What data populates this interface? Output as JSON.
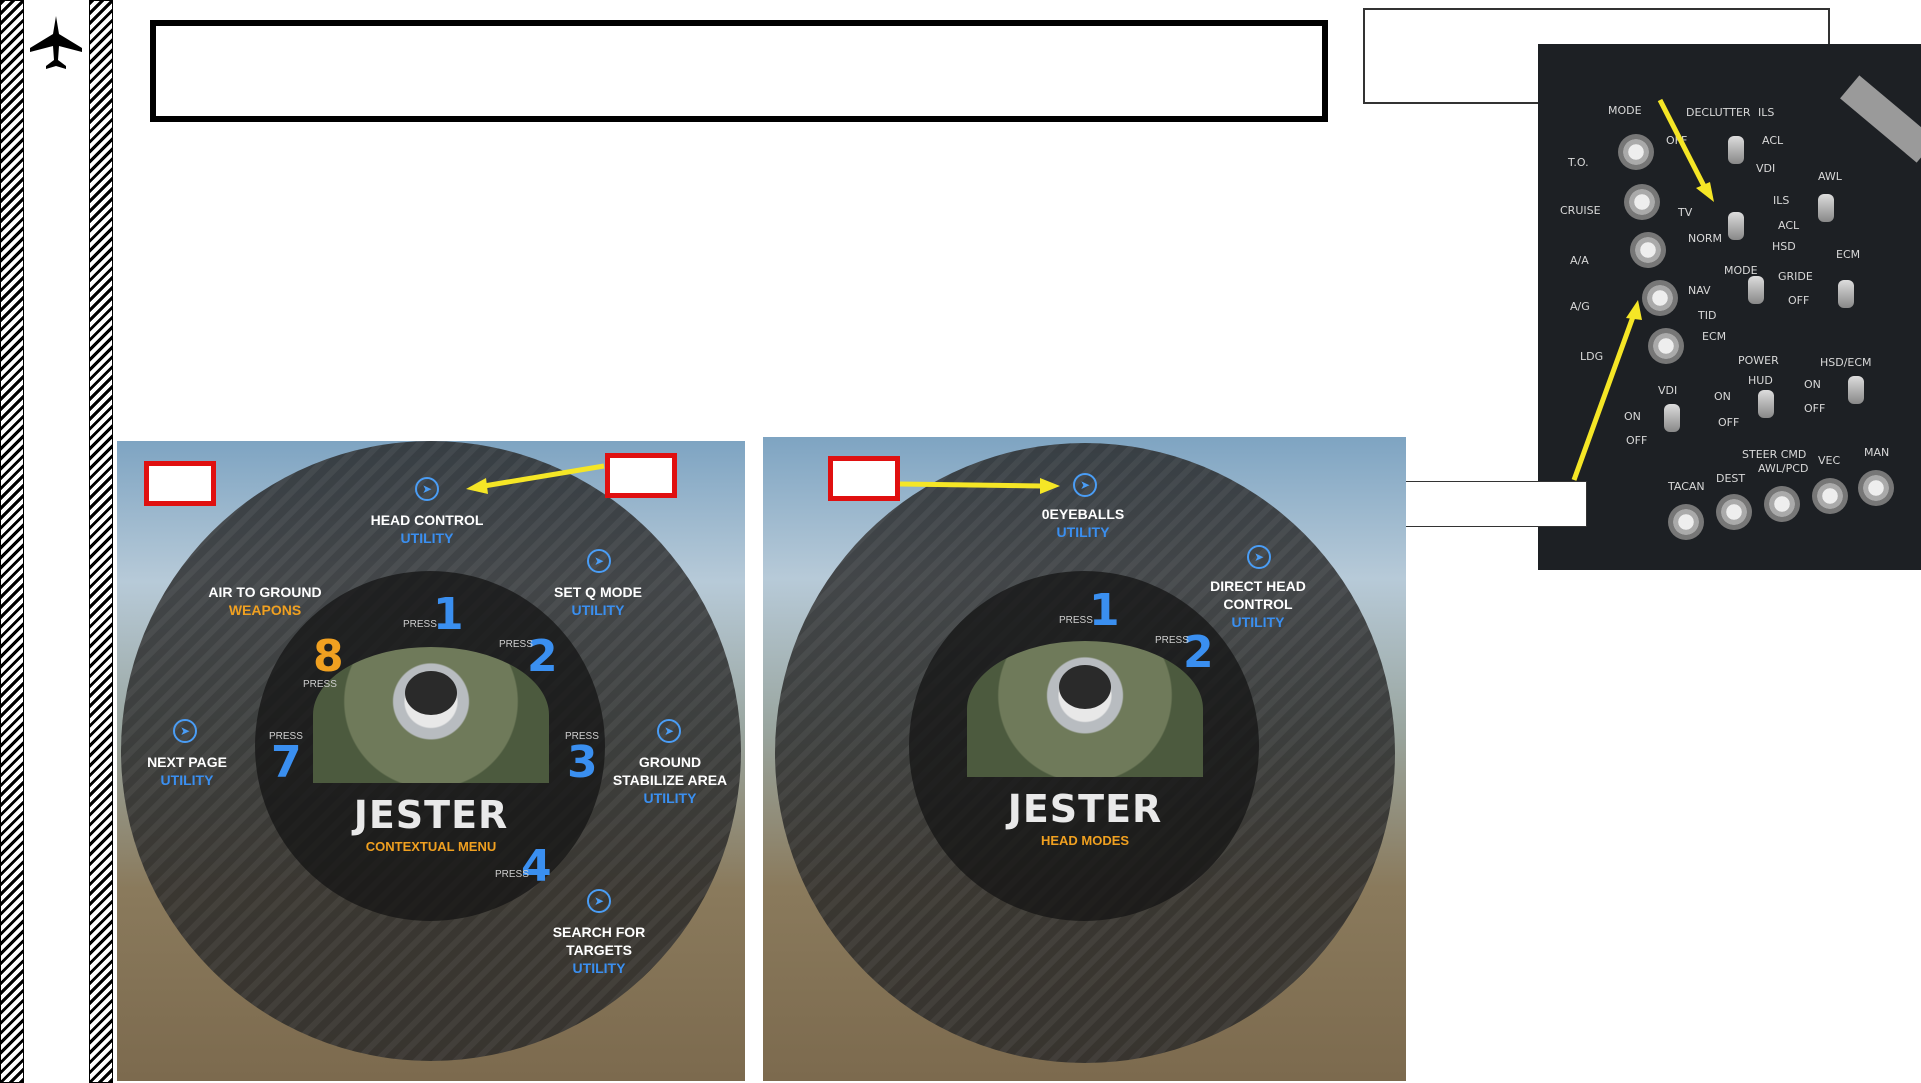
{
  "header": {
    "title_text": "",
    "note_text": ""
  },
  "left_menu": {
    "center_title": "JESTER",
    "center_subtitle": "CONTEXTUAL MENU",
    "press_label": "PRESS",
    "items": [
      {
        "label": "HEAD CONTROL",
        "category": "UTILITY",
        "key": "1"
      },
      {
        "label": "SET Q MODE",
        "category": "UTILITY",
        "key": "2"
      },
      {
        "label": "GROUND STABILIZE AREA",
        "category": "UTILITY",
        "key": "3"
      },
      {
        "label": "SEARCH FOR TARGETS",
        "category": "UTILITY",
        "key": "4"
      },
      {
        "label": "NEXT PAGE",
        "category": "UTILITY",
        "key": "7"
      },
      {
        "label": "AIR TO GROUND",
        "category": "WEAPONS",
        "key": "8"
      }
    ]
  },
  "right_menu": {
    "center_title": "JESTER",
    "center_subtitle": "HEAD MODES",
    "press_label": "PRESS",
    "items": [
      {
        "label": "0EYEBALLS",
        "category": "UTILITY",
        "key": "1"
      },
      {
        "label": "DIRECT HEAD CONTROL",
        "category": "UTILITY",
        "key": "2"
      }
    ]
  },
  "panel": {
    "labels": {
      "mode": "MODE",
      "declutter": "DECLUTTER",
      "on": "ON",
      "off": "OFF",
      "ils": "ILS",
      "acl": "ACL",
      "vdi": "VDI",
      "awl": "AWL",
      "to": "T.O.",
      "cruise": "CRUISE",
      "tv": "TV",
      "norm": "NORM",
      "aa": "A/A",
      "ag": "A/G",
      "hsd": "HSD",
      "ecm": "ECM",
      "nav": "NAV",
      "tid": "TID",
      "gride": "GRIDE",
      "ldg": "LDG",
      "power": "POWER",
      "hud": "HUD",
      "hsd_ecm": "HSD/ECM",
      "steer_cmd": "STEER CMD",
      "tacan": "TACAN",
      "dest": "DEST",
      "awl_pcd": "AWL/PCD",
      "vec": "VEC",
      "man": "MAN"
    }
  },
  "colors": {
    "accent_blue": "#3a8ff0",
    "accent_orange": "#f0a020",
    "arrow_yellow": "#f5e626",
    "callout_red": "#e01010"
  }
}
